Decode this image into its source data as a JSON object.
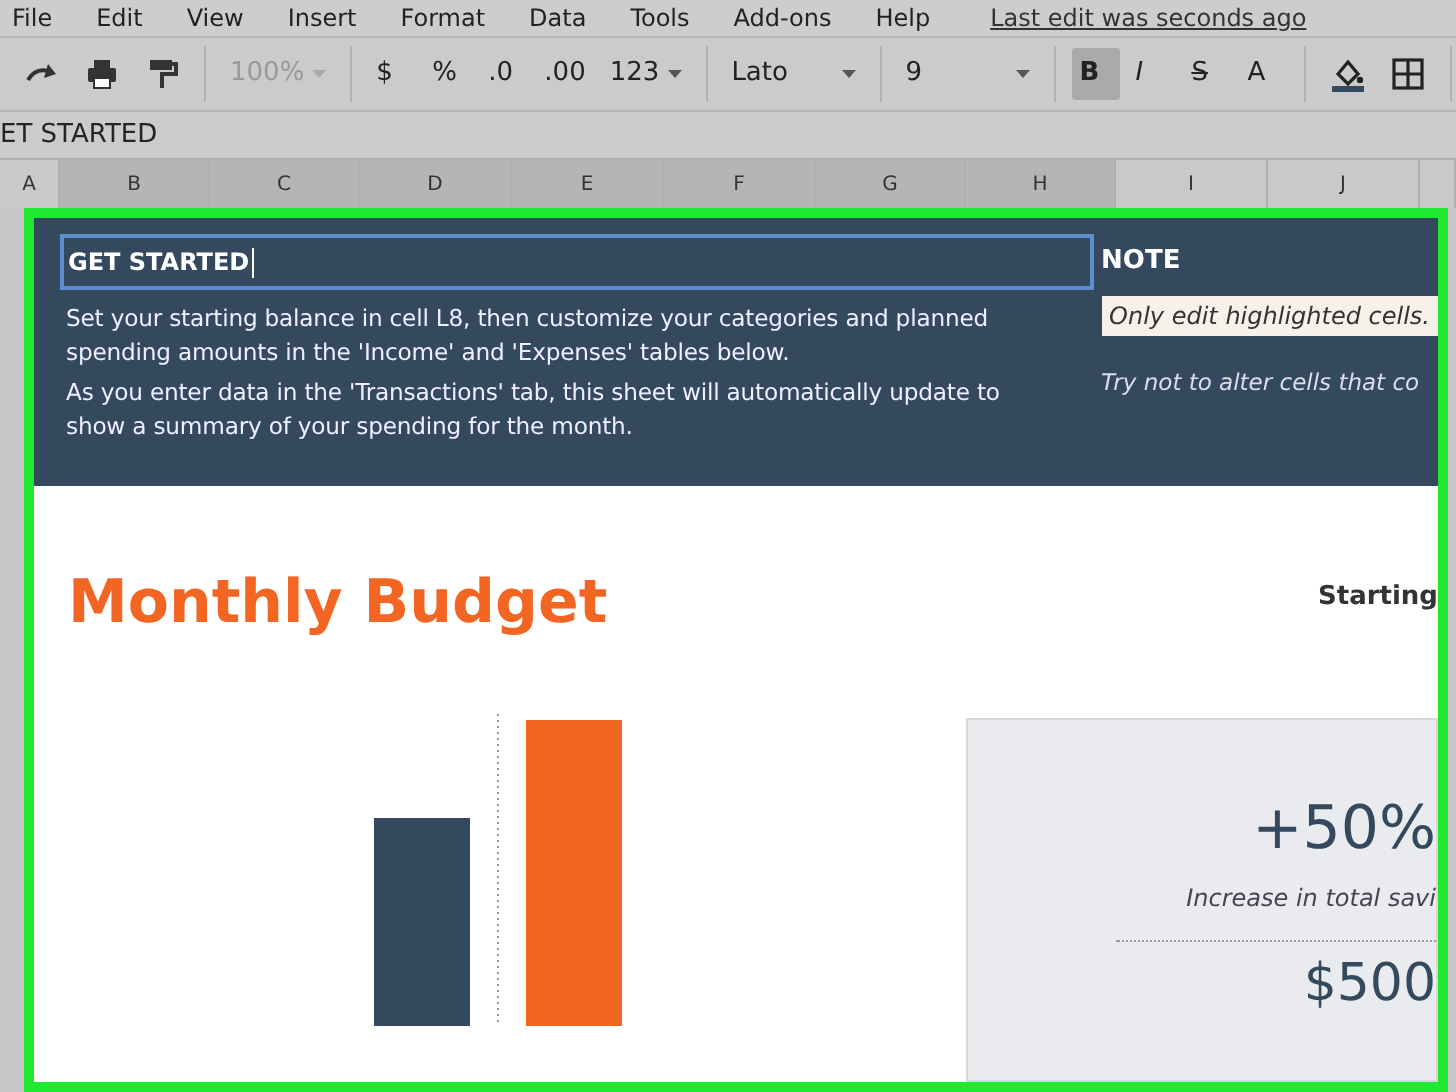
{
  "menu_bar": {
    "items": [
      "File",
      "Edit",
      "View",
      "Insert",
      "Format",
      "Data",
      "Tools",
      "Add-ons",
      "Help"
    ],
    "last_edit": "Last edit was seconds ago"
  },
  "toolbar": {
    "groups": [
      [
        {
          "kind": "redo"
        },
        {
          "kind": "print"
        },
        {
          "kind": "paint-format"
        }
      ],
      [
        {
          "kind": "dropdown",
          "label": "100%",
          "disabled": true
        }
      ],
      [
        {
          "kind": "text",
          "label": "$"
        },
        {
          "kind": "text",
          "label": "%"
        },
        {
          "kind": "decimal-less",
          "label": ".0"
        },
        {
          "kind": "decimal-more",
          "label": ".00"
        },
        {
          "kind": "dropdown",
          "label": "123",
          "disabled": false
        }
      ],
      [
        {
          "kind": "dropdown",
          "label": "Lato",
          "disabled": false,
          "wide": true
        }
      ],
      [
        {
          "kind": "dropdown",
          "label": "9",
          "disabled": false,
          "wide": true
        }
      ],
      [
        {
          "kind": "bold",
          "label": "B",
          "selected": true
        },
        {
          "kind": "italic",
          "label": "I",
          "selected": false
        },
        {
          "kind": "strike",
          "label": "S",
          "selected": false
        },
        {
          "kind": "text",
          "label": "A"
        }
      ],
      [
        {
          "kind": "fill-color"
        },
        {
          "kind": "borders"
        }
      ]
    ]
  },
  "formula_bar": {
    "value": "ET STARTED"
  },
  "columns": [
    {
      "label": "A",
      "selected": false
    },
    {
      "label": "B",
      "selected": true
    },
    {
      "label": "C",
      "selected": true
    },
    {
      "label": "D",
      "selected": true
    },
    {
      "label": "E",
      "selected": true
    },
    {
      "label": "F",
      "selected": true
    },
    {
      "label": "G",
      "selected": true
    },
    {
      "label": "H",
      "selected": true
    },
    {
      "label": "I",
      "selected": false
    },
    {
      "label": "J",
      "selected": false
    }
  ],
  "intro": {
    "title": "GET STARTED",
    "paragraphs": [
      "Set your starting balance in cell L8, then customize your categories and planned spending amounts in the 'Income' and 'Expenses' tables below.",
      "As you enter data in the 'Transactions' tab, this sheet will automatically update to show a summary of your spending for the month."
    ],
    "note_title": "NOTE",
    "note_highlight": "Only edit highlighted cells.",
    "note_text": "Try not to alter cells that co"
  },
  "budget": {
    "title": "Monthly Budget",
    "starting_label": "Starting",
    "summary": {
      "percent": "+50%",
      "caption": "Increase in total savi",
      "amount": "$500"
    }
  }
}
